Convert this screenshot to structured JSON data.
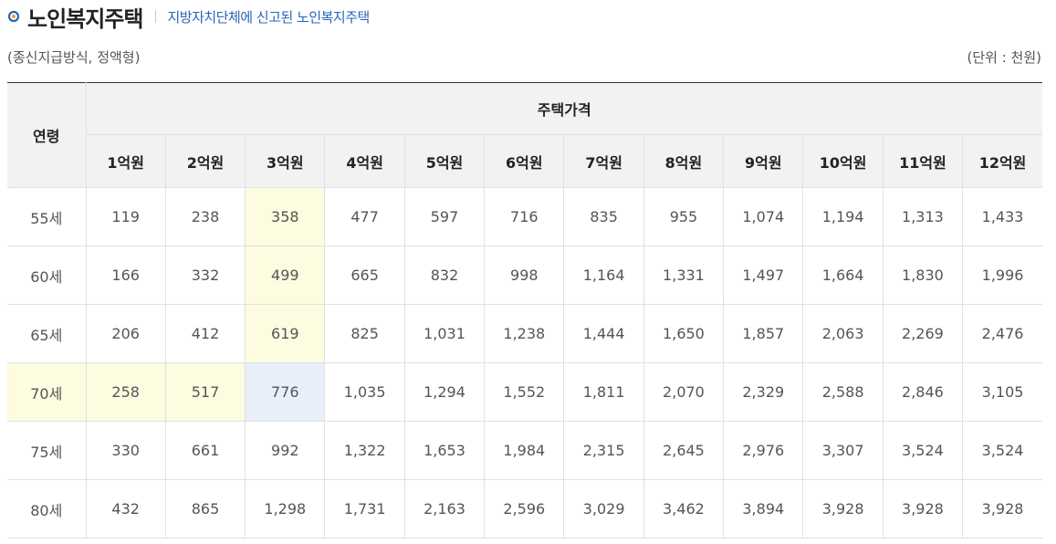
{
  "header": {
    "title": "노인복지주택",
    "subtitle": "지방자치단체에 신고된 노인복지주택"
  },
  "meta": {
    "left_note": "(종신지급방식, 정액형)",
    "unit": "(단위 : 천원)"
  },
  "table": {
    "age_header": "연령",
    "group_header": "주택가격",
    "price_headers": [
      "1억원",
      "2억원",
      "3억원",
      "4억원",
      "5억원",
      "6억원",
      "7억원",
      "8억원",
      "9억원",
      "10억원",
      "11억원",
      "12억원"
    ],
    "rows": [
      {
        "age": "55세",
        "values": [
          "119",
          "238",
          "358",
          "477",
          "597",
          "716",
          "835",
          "955",
          "1,074",
          "1,194",
          "1,313",
          "1,433"
        ]
      },
      {
        "age": "60세",
        "values": [
          "166",
          "332",
          "499",
          "665",
          "832",
          "998",
          "1,164",
          "1,331",
          "1,497",
          "1,664",
          "1,830",
          "1,996"
        ]
      },
      {
        "age": "65세",
        "values": [
          "206",
          "412",
          "619",
          "825",
          "1,031",
          "1,238",
          "1,444",
          "1,650",
          "1,857",
          "2,063",
          "2,269",
          "2,476"
        ]
      },
      {
        "age": "70세",
        "values": [
          "258",
          "517",
          "776",
          "1,035",
          "1,294",
          "1,552",
          "1,811",
          "2,070",
          "2,329",
          "2,588",
          "2,846",
          "3,105"
        ]
      },
      {
        "age": "75세",
        "values": [
          "330",
          "661",
          "992",
          "1,322",
          "1,653",
          "1,984",
          "2,315",
          "2,645",
          "2,976",
          "3,307",
          "3,524",
          "3,524"
        ]
      },
      {
        "age": "80세",
        "values": [
          "432",
          "865",
          "1,298",
          "1,731",
          "2,163",
          "2,596",
          "3,029",
          "3,462",
          "3,894",
          "3,928",
          "3,928",
          "3,928"
        ]
      }
    ],
    "highlight": {
      "column_index": 2,
      "row_index": 3,
      "yellow": "#fdfbe0",
      "blue": "#e8effb"
    }
  },
  "colors": {
    "accent_blue": "#2a64b8",
    "header_bg": "#f2f2f2"
  }
}
